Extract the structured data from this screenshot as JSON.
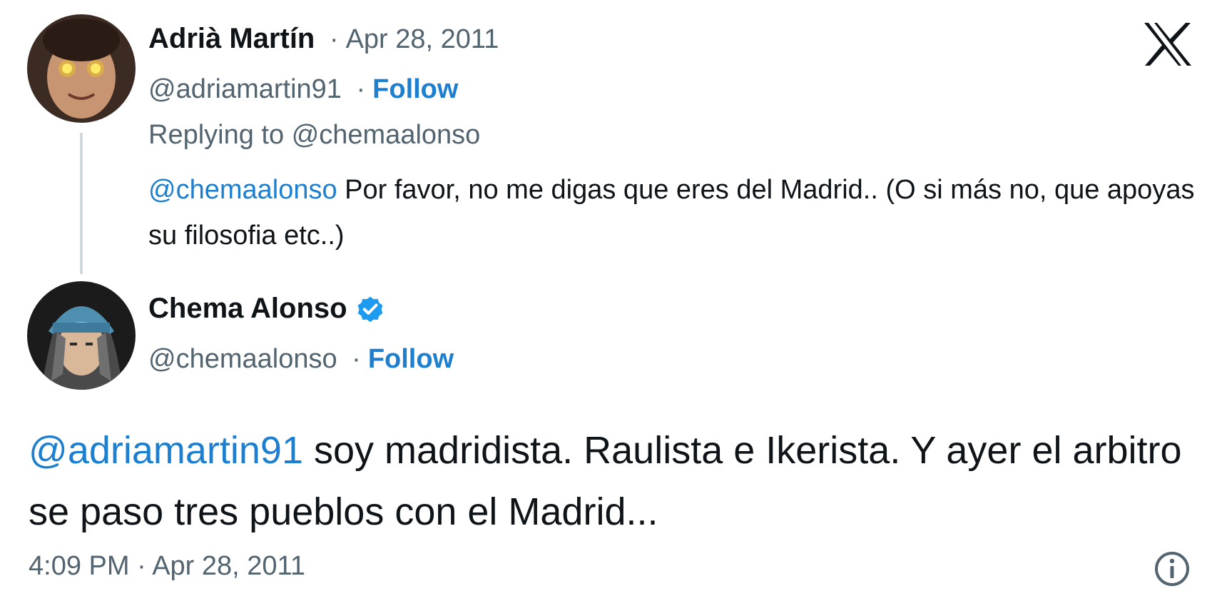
{
  "reply_tweet": {
    "display_name": "Adrià Martín",
    "date": "Apr 28, 2011",
    "handle": "@adriamartin91",
    "follow_label": "Follow",
    "replying_to_label": "Replying to",
    "replying_to_handle": "@chemaalonso",
    "mention": "@chemaalonso",
    "text": " Por favor, no me digas que eres del Madrid.. (O si más no, que apoyas su filosofia etc..)"
  },
  "main_tweet": {
    "display_name": "Chema Alonso",
    "handle": "@chemaalonso",
    "follow_label": "Follow",
    "verified": true,
    "mention": "@adriamartin91",
    "text": " soy madridista. Raulista e Ikerista. Y ayer el arbitro se paso tres pueblos con el Madrid...",
    "timestamp": "4:09 PM · Apr 28, 2011"
  },
  "separator": "·",
  "icons": {
    "brand": "x-logo-icon",
    "info": "info-icon",
    "verified": "verified-badge-icon"
  },
  "colors": {
    "link": "#1d7fd0",
    "secondary_text": "#536471",
    "primary_text": "#0f1419",
    "verified": "#1d9bf0"
  }
}
